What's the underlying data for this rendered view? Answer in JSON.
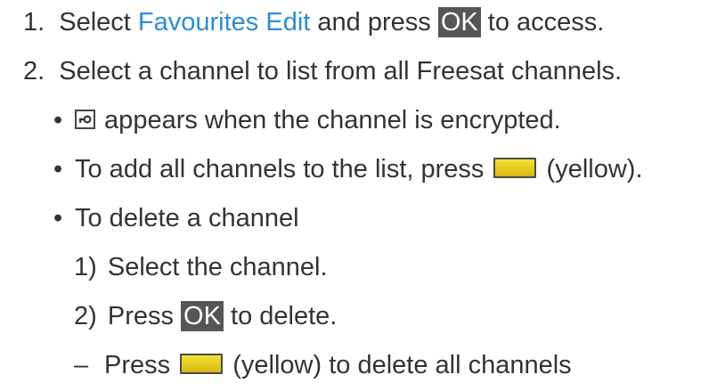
{
  "steps": [
    {
      "num": "1.",
      "text_before": "Select ",
      "link": "Favourites Edit",
      "text_mid": " and press ",
      "key": "OK",
      "text_after": " to access."
    },
    {
      "num": "2.",
      "text": "Select a channel to list from all Freesat channels."
    }
  ],
  "bullets": [
    {
      "marker": "•",
      "icon": "encrypted-key-icon",
      "text": " appears when the channel is encrypted."
    },
    {
      "marker": "•",
      "text_before": "To add all channels to the list, press ",
      "button": "yellow-button",
      "text_after": " (yellow)."
    },
    {
      "marker": "•",
      "text": "To delete a channel"
    }
  ],
  "substeps": [
    {
      "num": "1)",
      "text": "Select the channel."
    },
    {
      "num": "2)",
      "text_before": "Press ",
      "key": "OK",
      "text_after": " to delete."
    }
  ],
  "note": {
    "marker": "–",
    "text_before": "Press ",
    "button": "yellow-button",
    "text_after": " (yellow) to delete all channels"
  },
  "colors": {
    "link": "#2a8ed6",
    "ok_key_bg": "#565656",
    "yellow_button": "#f4e12e"
  }
}
